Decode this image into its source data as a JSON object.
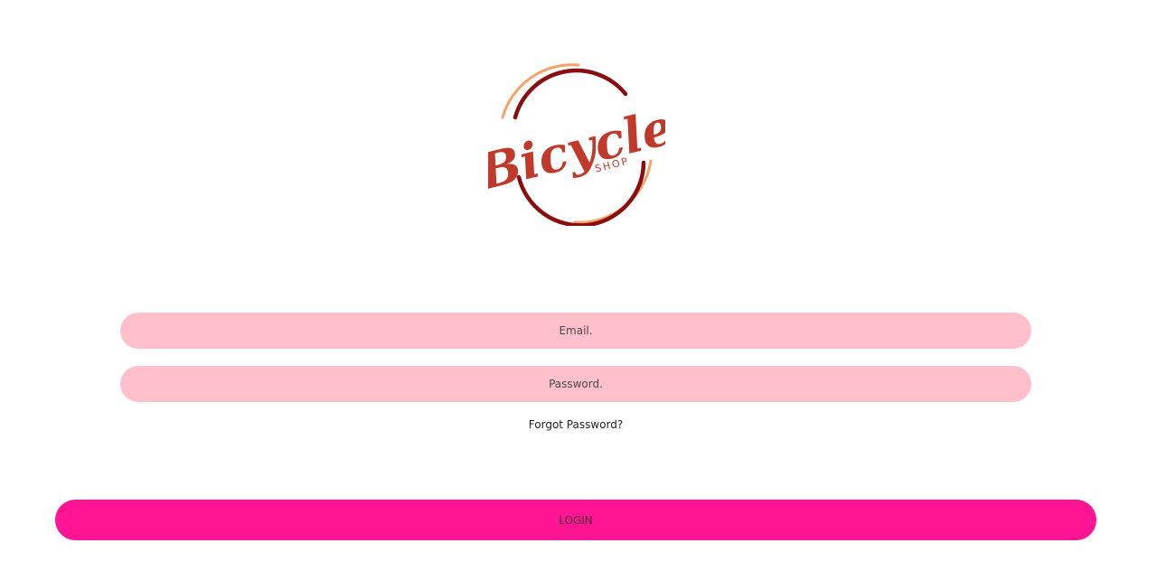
{
  "logo": {
    "brand_text": "Bicycle",
    "sub_text": "SHOP"
  },
  "form": {
    "email_placeholder": "Email.",
    "password_placeholder": "Password.",
    "forgot_label": "Forgot Password?",
    "login_label": "LOGIN"
  },
  "colors": {
    "field_bg": "#ffc0cb",
    "button_bg": "#ff1493",
    "logo_red": "#c0392b",
    "logo_dark": "#8b0e0e",
    "logo_orange": "#f4a46a"
  }
}
